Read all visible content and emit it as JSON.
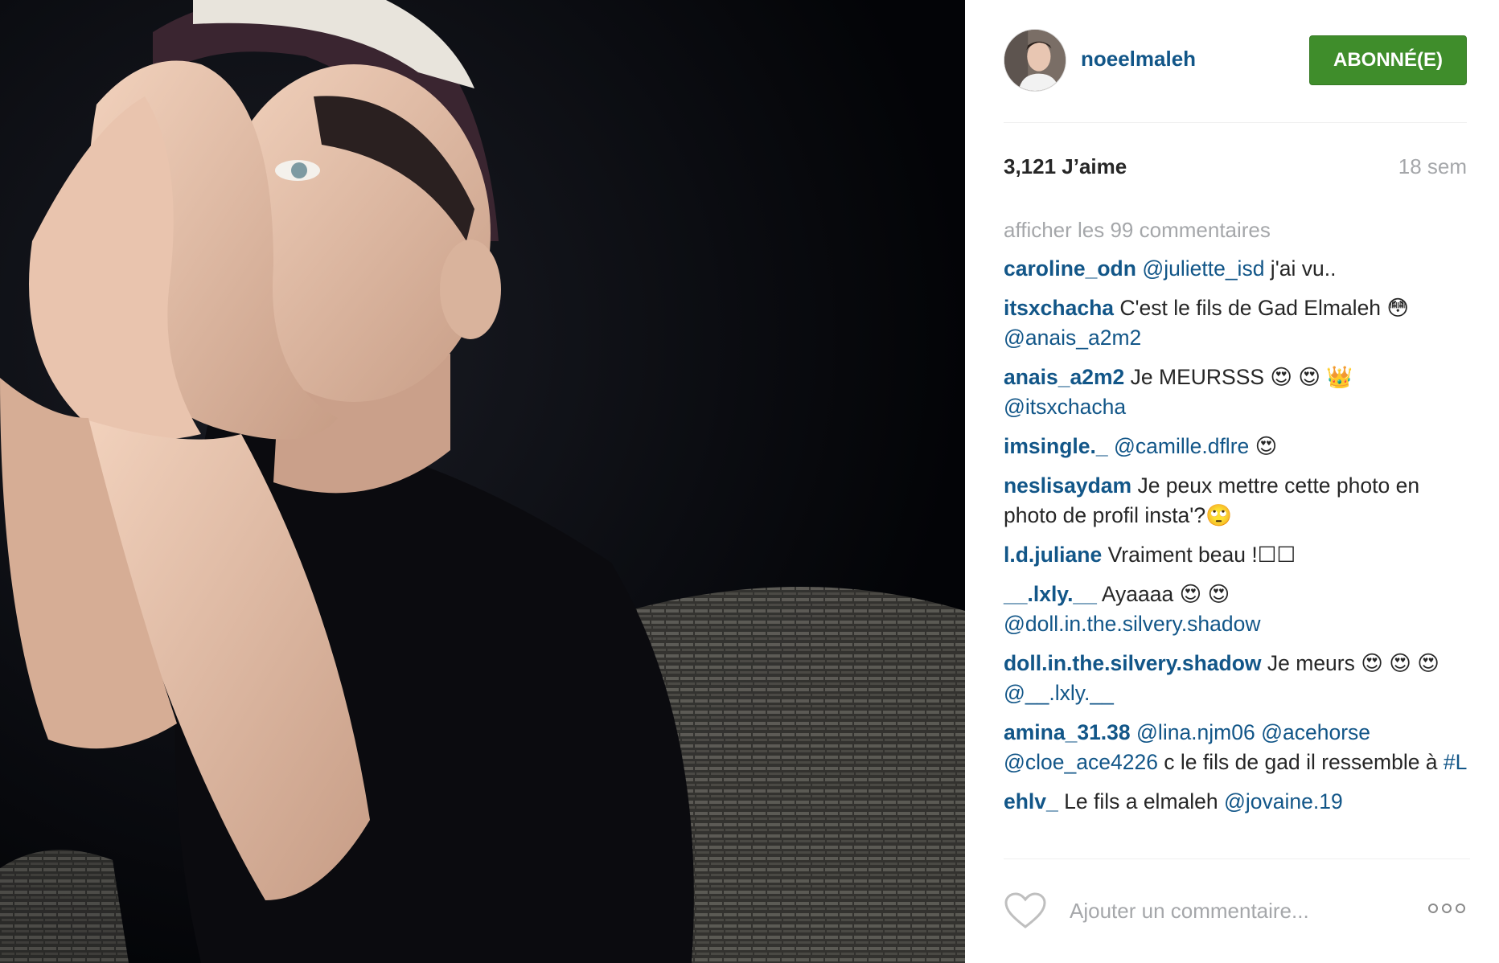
{
  "post": {
    "username": "noeelmaleh",
    "follow_label": "ABONNÉ(E)",
    "likes": "3,121 J’aime",
    "age": "18 sem",
    "view_all": "afficher les 99 commentaires",
    "add_comment_placeholder": "Ajouter un commentaire...",
    "accent_color": "#3f8d2b",
    "link_color": "#125688"
  },
  "comments": [
    {
      "user": "caroline_odn",
      "mention1": "@juliette_isd",
      "text1": " j'ai vu.."
    },
    {
      "user": "itsxchacha",
      "text1": " C'est le fils de Gad Elmaleh 😳 ",
      "mention1": "@anais_a2m2"
    },
    {
      "user": "anais_a2m2",
      "text1": " Je MEURSSS 😍 😍 👑 ",
      "mention1": "@itsxchacha"
    },
    {
      "user": "imsingle._",
      "text0": " ",
      "mention1": "@camille.dflre",
      "text1": " 😍"
    },
    {
      "user": "neslisaydam",
      "text1": " Je peux mettre cette photo en photo de profil insta'?🙄"
    },
    {
      "user": "l.d.juliane",
      "text1": " Vraiment beau !☐☐"
    },
    {
      "user": "__.lxly.__",
      "text1": " Ayaaaa 😍 😍 ",
      "mention1": "@doll.in.the.silvery.shadow"
    },
    {
      "user": "doll.in.the.silvery.shadow",
      "text1": " Je meurs 😍 😍 😍  ",
      "mention1": "@__.lxly.__"
    },
    {
      "user": "amina_31.38",
      "text0": " ",
      "mention1": "@lina.njm06",
      "text1": " ",
      "mention2": "@acehorse",
      "text2": " ",
      "mention3": "@cloe_ace4226",
      "text3": " c le fils de gad il ressemble à ",
      "mention4": "#L"
    },
    {
      "user": "ehlv_",
      "text1": " Le fils a elmaleh ",
      "mention1": "@jovaine.19"
    }
  ]
}
